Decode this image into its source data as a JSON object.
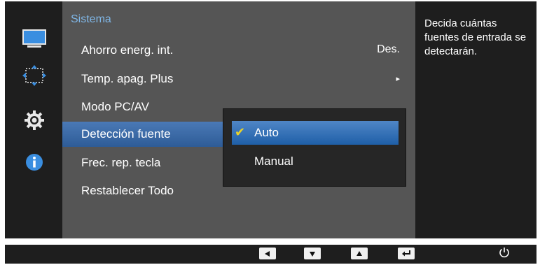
{
  "menu": {
    "title": "Sistema",
    "items": [
      {
        "label": "Ahorro energ. int.",
        "value": "Des."
      },
      {
        "label": "Temp. apag. Plus",
        "value": "▸"
      },
      {
        "label": "Modo PC/AV",
        "value": ""
      },
      {
        "label": "Detección fuente",
        "value": ""
      },
      {
        "label": "Frec. rep. tecla",
        "value": ""
      },
      {
        "label": "Restablecer Todo",
        "value": ""
      }
    ],
    "selected_index": 3
  },
  "submenu": {
    "options": [
      {
        "label": "Auto",
        "checked": true
      },
      {
        "label": "Manual",
        "checked": false
      }
    ]
  },
  "help": {
    "text": "Decida cuántas fuentes de entrada se detectarán."
  },
  "sidebar": {
    "icons": [
      "picture-icon",
      "onscreen-display-icon",
      "gear-icon",
      "info-icon"
    ]
  },
  "bottom_bar": {
    "buttons": [
      "left-arrow-button",
      "down-arrow-button",
      "up-arrow-button",
      "enter-button",
      "power-button"
    ]
  },
  "colors": {
    "title": "#7fb6e6",
    "highlight": "#2e5c97",
    "check": "#e8d22a"
  }
}
